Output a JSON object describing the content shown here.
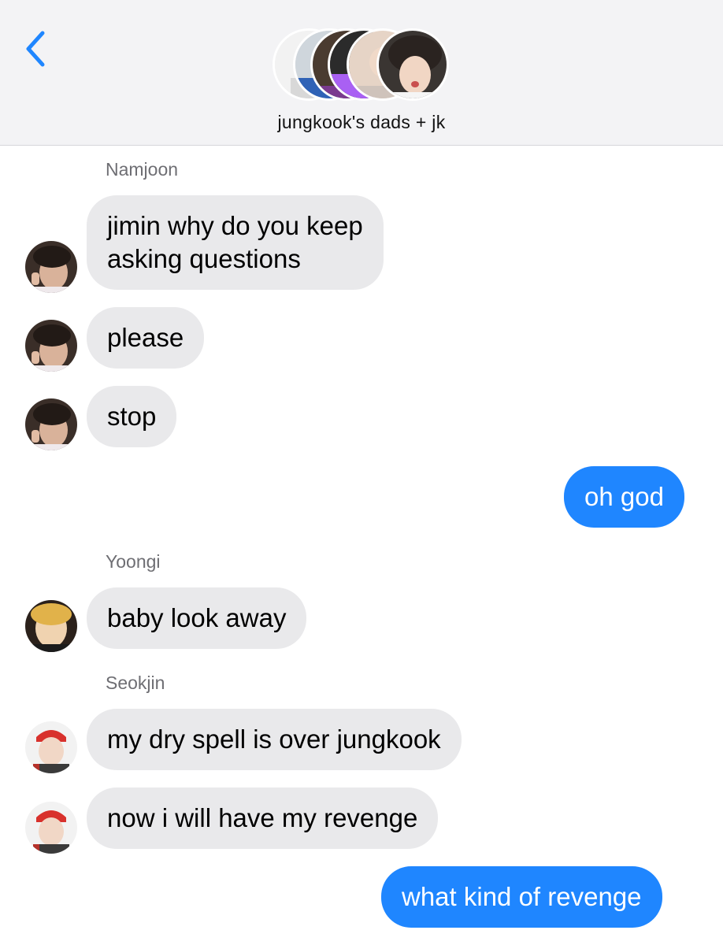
{
  "header": {
    "group_name": "jungkook's dads + jk",
    "back_icon": "chevron-left-icon",
    "accent_color": "#1f86ff"
  },
  "messages": [
    {
      "sender": "Namjoon",
      "direction": "incoming",
      "lines": [
        "jimin why do you keep",
        "asking questions"
      ]
    },
    {
      "sender": "Namjoon",
      "direction": "incoming",
      "lines": [
        "please"
      ]
    },
    {
      "sender": "Namjoon",
      "direction": "incoming",
      "lines": [
        "stop"
      ]
    },
    {
      "sender": "",
      "direction": "outgoing",
      "lines": [
        "oh god"
      ]
    },
    {
      "sender": "Yoongi",
      "direction": "incoming",
      "lines": [
        "baby look away"
      ]
    },
    {
      "sender": "Seokjin",
      "direction": "incoming",
      "lines": [
        "my dry spell is over jungkook"
      ]
    },
    {
      "sender": "Seokjin",
      "direction": "incoming",
      "lines": [
        "now i will have my revenge"
      ]
    },
    {
      "sender": "",
      "direction": "outgoing",
      "lines": [
        "what kind of revenge"
      ]
    }
  ],
  "labels": {
    "namjoon": "Namjoon",
    "yoongi": "Yoongi",
    "seokjin": "Seokjin"
  },
  "colors": {
    "incoming_bubble": "#e9e9eb",
    "outgoing_bubble": "#1f86ff",
    "header_bg": "#f3f3f5"
  }
}
